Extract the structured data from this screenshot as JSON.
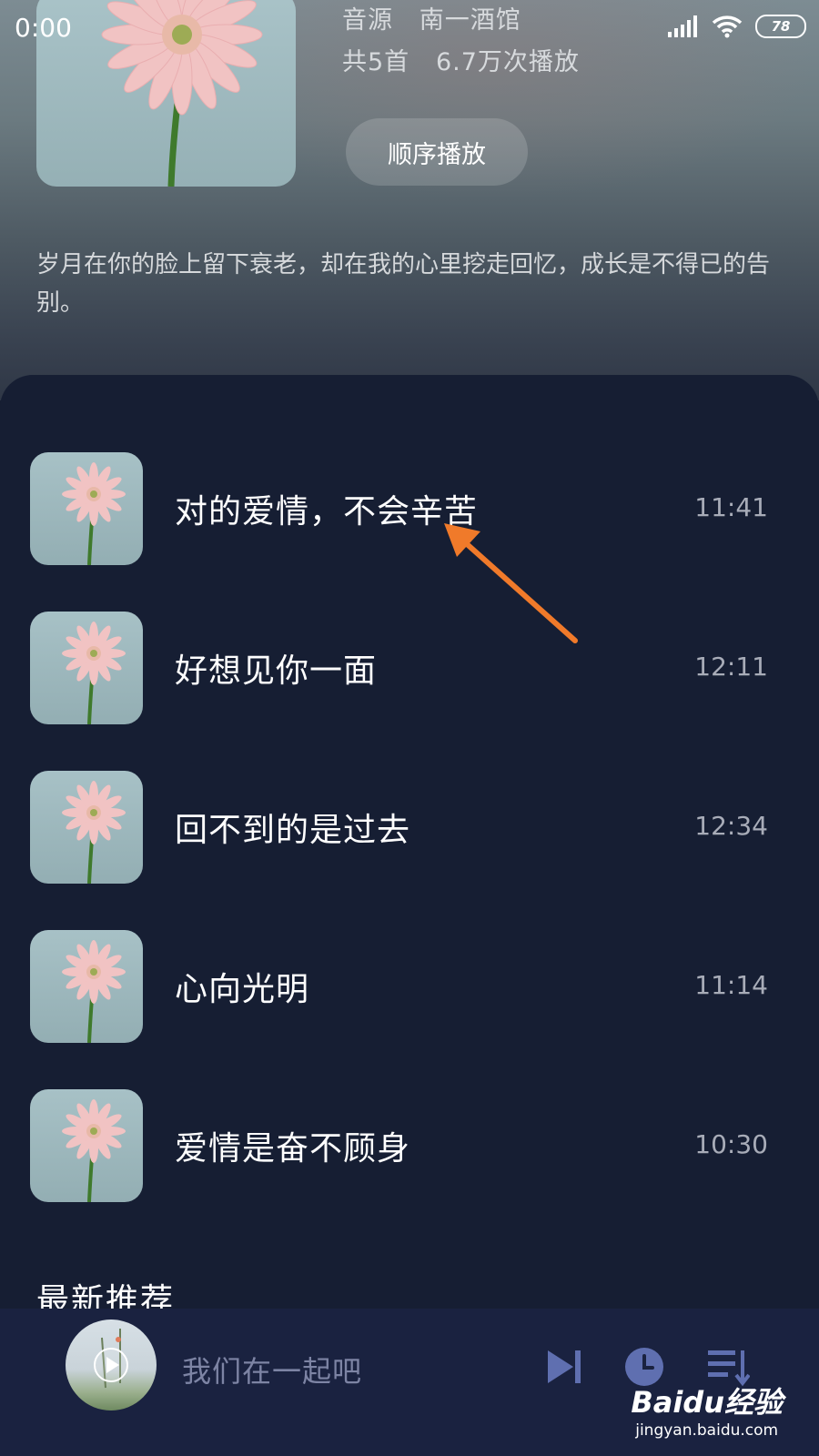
{
  "status_bar": {
    "time": "0:00",
    "battery": "78"
  },
  "album": {
    "source_label": "音源",
    "source_value": "南一酒馆",
    "count_label": "共5首",
    "plays": "6.7万次播放",
    "play_order_label": "顺序播放",
    "description": "岁月在你的脸上留下衰老，却在我的心里挖走回忆，成长是不得已的告别。"
  },
  "songs": [
    {
      "title": "对的爱情，不会辛苦",
      "duration": "11:41"
    },
    {
      "title": "好想见你一面",
      "duration": "12:11"
    },
    {
      "title": "回不到的是过去",
      "duration": "12:34"
    },
    {
      "title": "心向光明",
      "duration": "11:14"
    },
    {
      "title": "爱情是奋不顾身",
      "duration": "10:30"
    }
  ],
  "section": {
    "title": "最新推荐"
  },
  "mini_player": {
    "title": "我们在一起吧",
    "icons": [
      "play-icon",
      "skip-next-icon",
      "timer-icon",
      "playlist-icon"
    ]
  },
  "watermark": {
    "logo": "Baidu经验",
    "url": "jingyan.baidu.com"
  },
  "colors": {
    "panel_bg": "#161e33",
    "player_bg": "#1a2240",
    "accent_icon": "#5f6fb0",
    "annotation_arrow": "#f07a2a"
  }
}
